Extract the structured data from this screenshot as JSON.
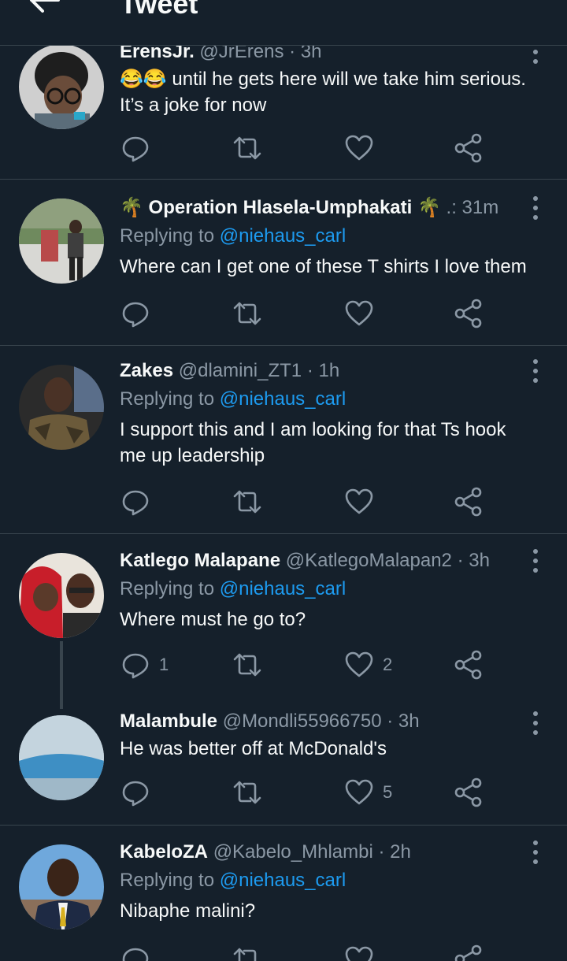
{
  "header": {
    "title": "Tweet"
  },
  "tweets": [
    {
      "name": "ErensJr.",
      "handle": "@JrErens",
      "time": "· 3h",
      "replying_prefix": "",
      "mention": "",
      "text": "😂😂 until he gets here will we take him serious. It’s a joke for now",
      "replies": "",
      "likes": ""
    },
    {
      "name": "🌴 Operation Hlasela-Umphakati 🌴",
      "handle": ".:",
      "time": "31m",
      "replying_prefix": "Replying to ",
      "mention": "@niehaus_carl",
      "text": "Where can I get one of these T shirts I love them",
      "replies": "",
      "likes": ""
    },
    {
      "name": "Zakes",
      "handle": "@dlamini_ZT1",
      "time": "· 1h",
      "replying_prefix": "Replying to ",
      "mention": "@niehaus_carl",
      "text": "I support this and I am looking for that Ts hook me up leadership",
      "replies": "",
      "likes": ""
    },
    {
      "name": "Katlego Malapane",
      "handle": "@KatlegoMalapan2",
      "time": "· 3h",
      "replying_prefix": "Replying to ",
      "mention": "@niehaus_carl",
      "text": "Where must he go to?",
      "replies": "1",
      "likes": "2"
    },
    {
      "name": "Malambule",
      "handle": "@Mondli55966750",
      "time": "· 3h",
      "replying_prefix": "",
      "mention": "",
      "text": "He was better off at McDonald's",
      "replies": "",
      "likes": "5"
    },
    {
      "name": "KabeloZA",
      "handle": "@Kabelo_Mhlambi",
      "time": "· 2h",
      "replying_prefix": "Replying to ",
      "mention": "@niehaus_carl",
      "text": "Nibaphe malini?",
      "replies": "",
      "likes": ""
    }
  ],
  "icons": {
    "back": "arrow-left-icon",
    "more": "more-vertical-icon",
    "reply": "reply-icon",
    "retweet": "retweet-icon",
    "like": "heart-icon",
    "share": "share-icon"
  },
  "colors": {
    "background": "#15202b",
    "text": "#f7f9f9",
    "secondary": "#8b98a5",
    "accent": "#1d9bf0",
    "divider": "#38444d"
  }
}
